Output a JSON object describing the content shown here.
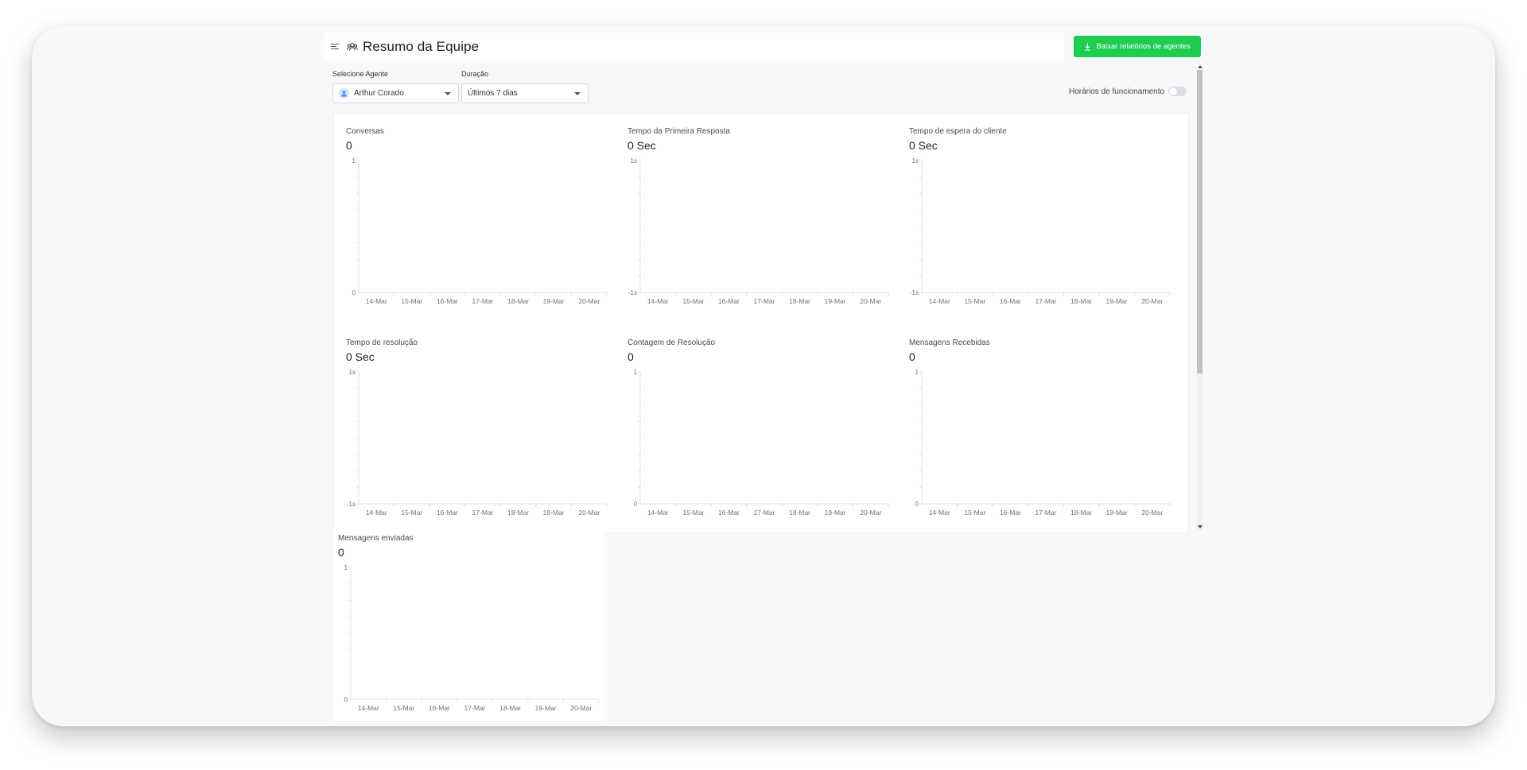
{
  "header": {
    "title": "Resumo da Equipe",
    "download_label": "Baixar relatórios de agentes"
  },
  "filters": {
    "agent_label": "Selecione Agente",
    "agent_value": "Arthur Corado",
    "duration_label": "Duração",
    "duration_value": "Últimos 7 dias",
    "hours_label": "Horários de funcionamento",
    "hours_enabled": false
  },
  "colors": {
    "accent": "#1dcc51",
    "axis": "#dcdfe4",
    "tick_text": "#6b7280"
  },
  "metrics": [
    {
      "title": "Conversas",
      "value": "0"
    },
    {
      "title": "Tempo da Primeira Resposta",
      "value": "0 Sec"
    },
    {
      "title": "Tempo de espera do cliente",
      "value": "0 Sec"
    },
    {
      "title": "Tempo de resolução",
      "value": "0 Sec"
    },
    {
      "title": "Contagem de Resolução",
      "value": "0"
    },
    {
      "title": "Mensagens Recebidas",
      "value": "0"
    },
    {
      "title": "Mensagens enviadas",
      "value": "0"
    }
  ],
  "chart_data": [
    {
      "type": "bar",
      "title": "Conversas",
      "categories": [
        "14-Mar",
        "15-Mar",
        "16-Mar",
        "17-Mar",
        "18-Mar",
        "19-Mar",
        "20-Mar"
      ],
      "values": [
        0,
        0,
        0,
        0,
        0,
        0,
        0
      ],
      "ylim": [
        0,
        1
      ],
      "ytick_labels": [
        "1",
        "0"
      ],
      "grid": false
    },
    {
      "type": "bar",
      "title": "Tempo da Primeira Resposta",
      "categories": [
        "14-Mar",
        "15-Mar",
        "16-Mar",
        "17-Mar",
        "18-Mar",
        "19-Mar",
        "20-Mar"
      ],
      "values": [
        0,
        0,
        0,
        0,
        0,
        0,
        0
      ],
      "ylim": [
        -1,
        1
      ],
      "ytick_labels": [
        "1s",
        "-1s"
      ],
      "grid": false
    },
    {
      "type": "bar",
      "title": "Tempo de espera do cliente",
      "categories": [
        "14-Mar",
        "15-Mar",
        "16-Mar",
        "17-Mar",
        "18-Mar",
        "19-Mar",
        "20-Mar"
      ],
      "values": [
        0,
        0,
        0,
        0,
        0,
        0,
        0
      ],
      "ylim": [
        -1,
        1
      ],
      "ytick_labels": [
        "1s",
        "-1s"
      ],
      "grid": false
    },
    {
      "type": "bar",
      "title": "Tempo de resolução",
      "categories": [
        "14-Mar",
        "15-Mar",
        "16-Mar",
        "17-Mar",
        "18-Mar",
        "19-Mar",
        "20-Mar"
      ],
      "values": [
        0,
        0,
        0,
        0,
        0,
        0,
        0
      ],
      "ylim": [
        -1,
        1
      ],
      "ytick_labels": [
        "1s",
        "-1s"
      ],
      "grid": false
    },
    {
      "type": "bar",
      "title": "Contagem de Resolução",
      "categories": [
        "14-Mar",
        "15-Mar",
        "16-Mar",
        "17-Mar",
        "18-Mar",
        "19-Mar",
        "20-Mar"
      ],
      "values": [
        0,
        0,
        0,
        0,
        0,
        0,
        0
      ],
      "ylim": [
        0,
        1
      ],
      "ytick_labels": [
        "1",
        "0"
      ],
      "grid": false
    },
    {
      "type": "bar",
      "title": "Mensagens Recebidas",
      "categories": [
        "14-Mar",
        "15-Mar",
        "16-Mar",
        "17-Mar",
        "18-Mar",
        "19-Mar",
        "20-Mar"
      ],
      "values": [
        0,
        0,
        0,
        0,
        0,
        0,
        0
      ],
      "ylim": [
        0,
        1
      ],
      "ytick_labels": [
        "1",
        "0"
      ],
      "grid": false
    },
    {
      "type": "bar",
      "title": "Mensagens enviadas",
      "categories": [
        "14-Mar",
        "15-Mar",
        "16-Mar",
        "17-Mar",
        "18-Mar",
        "19-Mar",
        "20-Mar"
      ],
      "values": [
        0,
        0,
        0,
        0,
        0,
        0,
        0
      ],
      "ylim": [
        0,
        1
      ],
      "ytick_labels": [
        "1",
        "0"
      ],
      "grid": false
    }
  ]
}
